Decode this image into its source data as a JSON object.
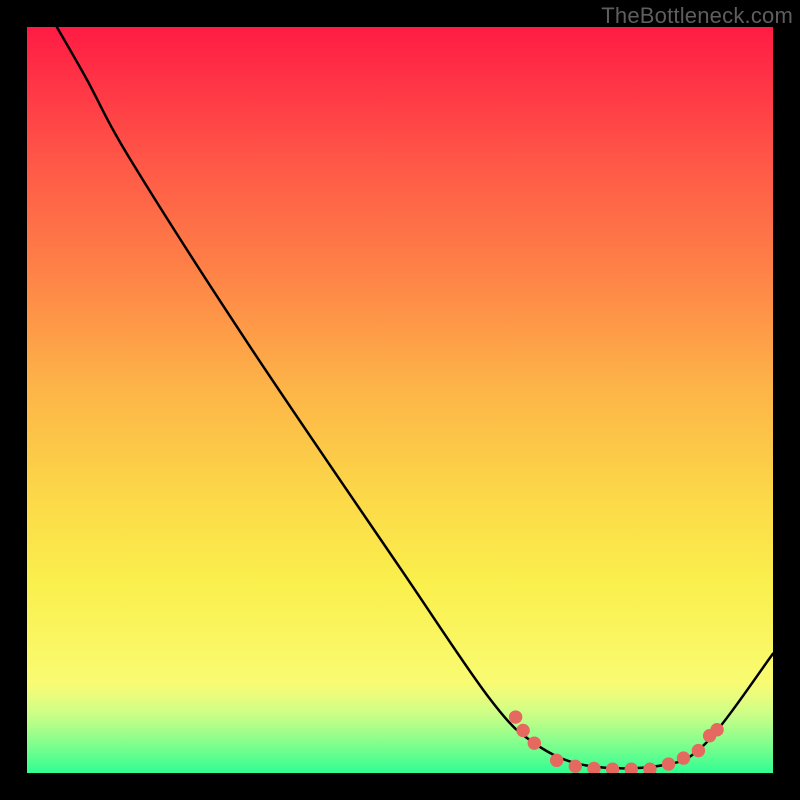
{
  "watermark": "TheBottleneck.com",
  "chart_data": {
    "type": "line",
    "title": "",
    "xlabel": "",
    "ylabel": "",
    "xlim": [
      0,
      100
    ],
    "ylim": [
      0,
      100
    ],
    "curve": [
      {
        "x": 4,
        "y": 100
      },
      {
        "x": 8,
        "y": 93
      },
      {
        "x": 14,
        "y": 82
      },
      {
        "x": 30,
        "y": 57
      },
      {
        "x": 50,
        "y": 27.5
      },
      {
        "x": 62,
        "y": 10
      },
      {
        "x": 68,
        "y": 4
      },
      {
        "x": 75,
        "y": 1
      },
      {
        "x": 85,
        "y": 1
      },
      {
        "x": 91,
        "y": 4
      },
      {
        "x": 100,
        "y": 16
      }
    ],
    "markers": [
      {
        "x": 65.5,
        "y": 7.5
      },
      {
        "x": 66.5,
        "y": 5.7
      },
      {
        "x": 68,
        "y": 4.0
      },
      {
        "x": 71,
        "y": 1.7
      },
      {
        "x": 73.5,
        "y": 0.9
      },
      {
        "x": 76,
        "y": 0.6
      },
      {
        "x": 78.5,
        "y": 0.5
      },
      {
        "x": 81,
        "y": 0.5
      },
      {
        "x": 83.5,
        "y": 0.5
      },
      {
        "x": 86,
        "y": 1.2
      },
      {
        "x": 88,
        "y": 2.0
      },
      {
        "x": 90,
        "y": 3.0
      },
      {
        "x": 91.5,
        "y": 5.0
      },
      {
        "x": 92.5,
        "y": 5.8
      }
    ],
    "gradient_stops": {
      "top_section": [
        {
          "pct": 0,
          "color": "#FF1B43"
        },
        {
          "pct": 8,
          "color": "#FF3346"
        },
        {
          "pct": 22,
          "color": "#FF5B47"
        },
        {
          "pct": 38,
          "color": "#FE8447"
        },
        {
          "pct": 55,
          "color": "#FDB448"
        },
        {
          "pct": 72,
          "color": "#FCD948"
        },
        {
          "pct": 85,
          "color": "#FAF04D"
        },
        {
          "pct": 100,
          "color": "#F9FB72"
        }
      ],
      "bottom_section": [
        {
          "pct": 0,
          "color": "#F9FB72"
        },
        {
          "pct": 15,
          "color": "#E8FC7E"
        },
        {
          "pct": 35,
          "color": "#CBFE87"
        },
        {
          "pct": 55,
          "color": "#9FFE8B"
        },
        {
          "pct": 75,
          "color": "#6FFE8E"
        },
        {
          "pct": 100,
          "color": "#30FE93"
        }
      ],
      "split_at_pct": 88
    }
  }
}
